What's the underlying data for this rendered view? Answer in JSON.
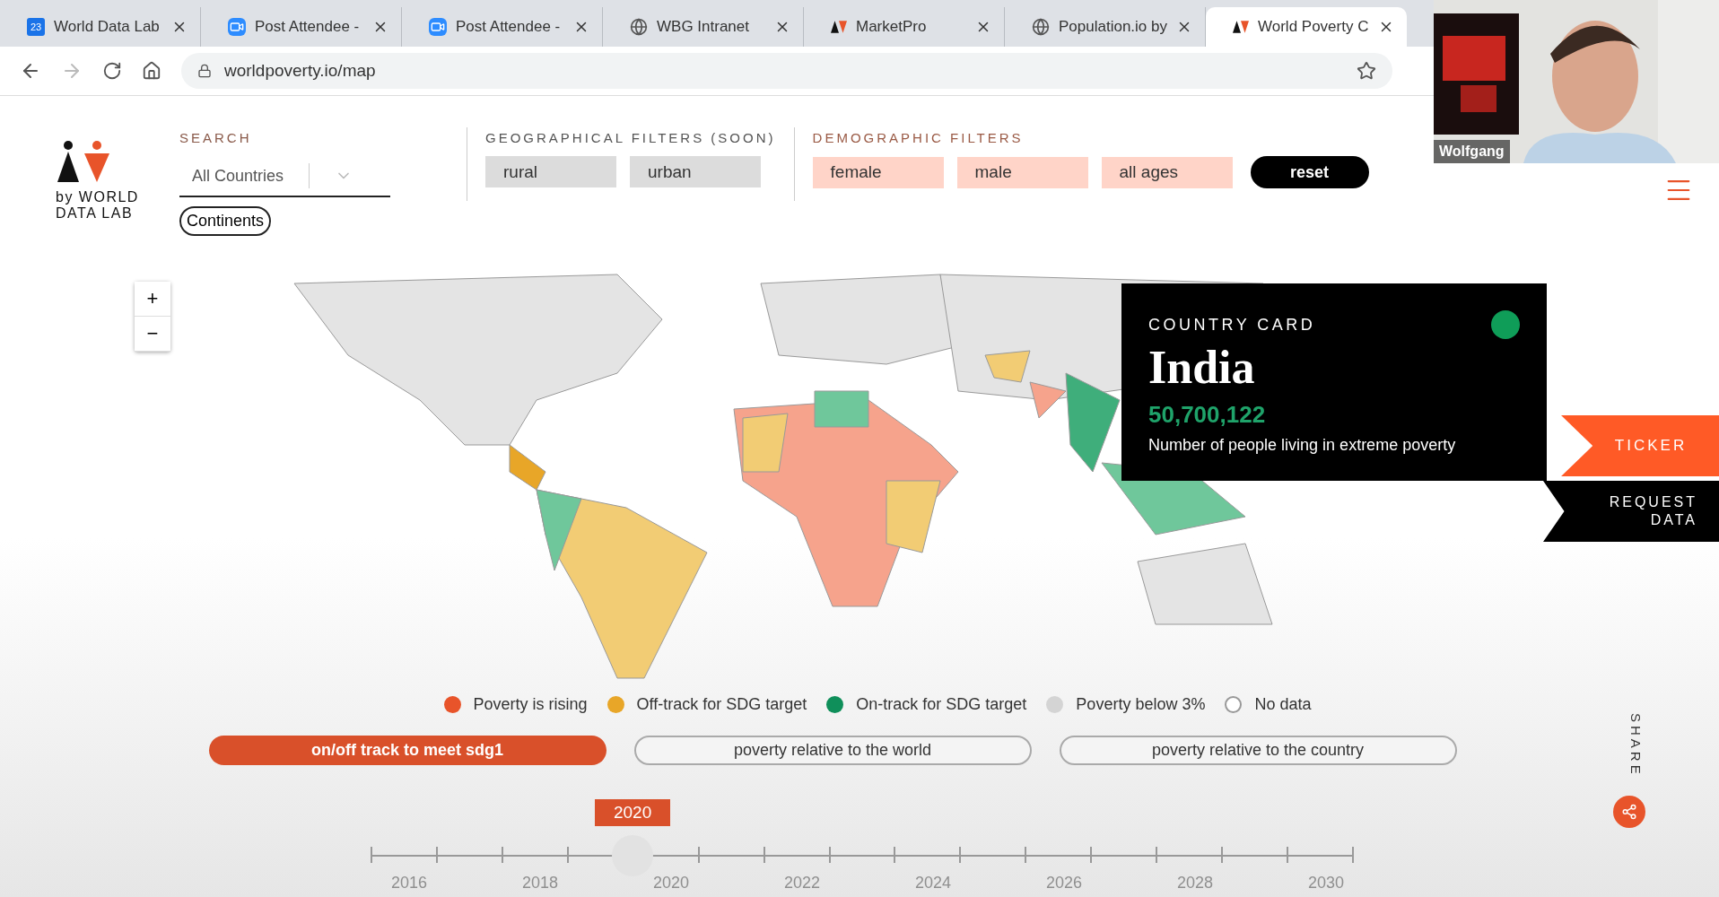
{
  "browser": {
    "tabs": [
      {
        "kind": "calendar",
        "title": "World Data Lab",
        "selected": false
      },
      {
        "kind": "video",
        "title": "Post Attendee -",
        "selected": false
      },
      {
        "kind": "video",
        "title": "Post Attendee -",
        "selected": false
      },
      {
        "kind": "globe",
        "title": "WBG Intranet",
        "selected": false
      },
      {
        "kind": "site",
        "title": "MarketPro",
        "selected": false
      },
      {
        "kind": "globe",
        "title": "Population.io by",
        "selected": false
      },
      {
        "kind": "site",
        "title": "World Poverty C",
        "selected": true
      }
    ],
    "calendar_day": "23",
    "address": "worldpoverty.io/map"
  },
  "video_call": {
    "participant": "Wolfgang"
  },
  "header": {
    "logo_text": "by WORLD DATA LAB",
    "search": {
      "label": "SEARCH",
      "value": "All Countries",
      "continents_button": "Continents"
    },
    "geographical_filters": {
      "label": "GEOGRAPHICAL FILTERS (SOON)",
      "options": [
        "rural",
        "urban"
      ]
    },
    "demographic_filters": {
      "label": "DEMOGRAPHIC FILTERS",
      "options": [
        "female",
        "male",
        "all ages"
      ],
      "reset": "reset"
    }
  },
  "map": {
    "zoom_in": "+",
    "zoom_out": "−"
  },
  "country_card": {
    "label": "COUNTRY CARD",
    "country": "India",
    "color": "#0f9d58",
    "value": "50,700,122",
    "caption": "Number of people living in extreme poverty"
  },
  "side_tabs": {
    "ticker": "TICKER",
    "request_data": "REQUEST DATA",
    "share": "SHARE"
  },
  "legend": [
    {
      "label": "Poverty is rising",
      "color": "#e8542a"
    },
    {
      "label": "Off-track for SDG target",
      "color": "#e8a628"
    },
    {
      "label": "On-track for SDG target",
      "color": "#0f8f5a"
    },
    {
      "label": "Poverty below 3%",
      "color": "#d4d4d4"
    },
    {
      "label": "No data",
      "color": "#ffffff"
    }
  ],
  "modes": [
    {
      "label": "on/off track to meet sdg1",
      "selected": true
    },
    {
      "label": "poverty relative to the world",
      "selected": false
    },
    {
      "label": "poverty relative to the country",
      "selected": false
    }
  ],
  "timeline": {
    "current": "2020",
    "level": 0.267,
    "labels": [
      "2016",
      "2018",
      "2020",
      "2022",
      "2024",
      "2026",
      "2028",
      "2030"
    ]
  }
}
